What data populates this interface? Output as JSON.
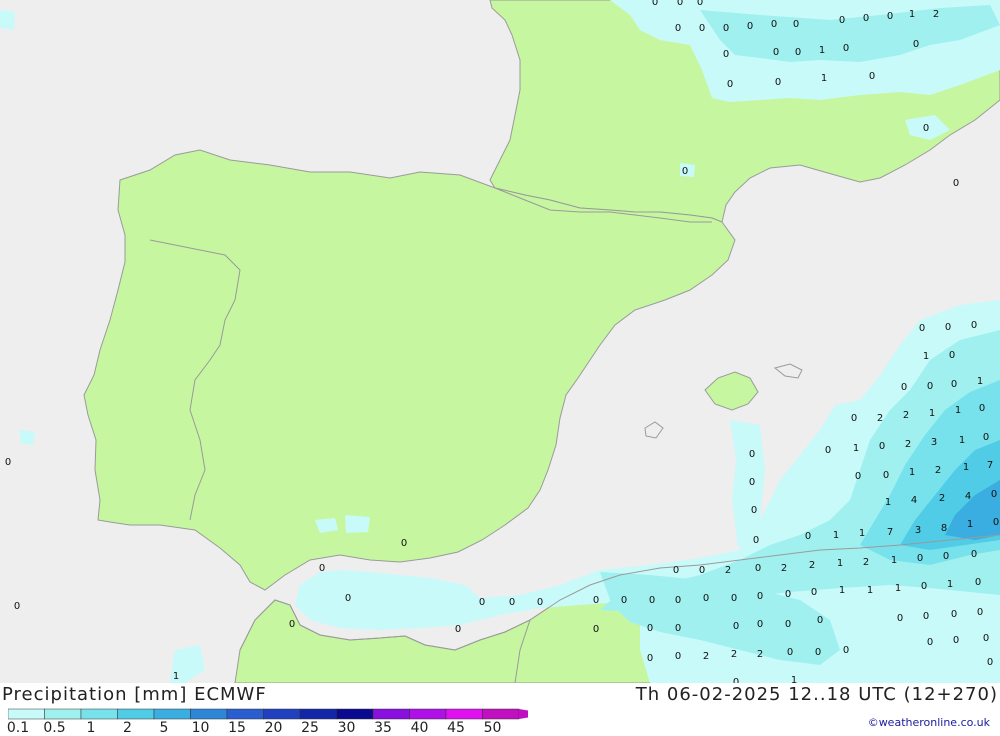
{
  "header": {
    "title": "Precipitation [mm] ECMWF",
    "datetime": "Th 06-02-2025 12..18 UTC (12+270)",
    "credit": "©weatheronline.co.uk"
  },
  "colors": {
    "land": "#c6f7a0",
    "sea": "#eeeeee",
    "border": "#9a9a9a",
    "precip_levels": [
      "#c8fafa",
      "#a0f0f0",
      "#78e2ec",
      "#50cce6",
      "#3aaee0",
      "#2e86d8",
      "#2a5ed0",
      "#2040c0",
      "#1426a8",
      "#0a0a90",
      "#8a10e0",
      "#b010e8",
      "#e010f0",
      "#c010c0"
    ]
  },
  "legend": {
    "labels": [
      "0.1",
      "0.5",
      "1",
      "2",
      "5",
      "10",
      "15",
      "20",
      "25",
      "30",
      "35",
      "40",
      "45",
      "50"
    ]
  },
  "map_values": [
    {
      "t": "0"
    },
    {
      "t": "0"
    },
    {
      "t": "0"
    },
    {
      "t": "1"
    },
    {
      "t": "2"
    },
    {
      "t": "0"
    },
    {
      "t": "0"
    },
    {
      "t": "0"
    },
    {
      "t": "0"
    },
    {
      "t": "0"
    },
    {
      "t": "0"
    },
    {
      "t": "0"
    },
    {
      "t": "0"
    },
    {
      "t": "0"
    },
    {
      "t": "0"
    },
    {
      "t": "0"
    },
    {
      "t": "0"
    },
    {
      "t": "1"
    },
    {
      "t": "0"
    },
    {
      "t": "0"
    },
    {
      "t": "0"
    },
    {
      "t": "1"
    },
    {
      "t": "0"
    },
    {
      "t": "0"
    },
    {
      "t": "0"
    },
    {
      "t": "0"
    },
    {
      "t": "0"
    },
    {
      "t": "0"
    },
    {
      "t": "0"
    },
    {
      "t": "0"
    },
    {
      "t": "0"
    },
    {
      "t": "0"
    },
    {
      "t": "1"
    },
    {
      "t": "0"
    },
    {
      "t": "0"
    },
    {
      "t": "0"
    },
    {
      "t": "1"
    },
    {
      "t": "0"
    },
    {
      "t": "0"
    },
    {
      "t": "2"
    },
    {
      "t": "2"
    },
    {
      "t": "1"
    },
    {
      "t": "1"
    },
    {
      "t": "0"
    },
    {
      "t": "0"
    },
    {
      "t": "1"
    },
    {
      "t": "0"
    },
    {
      "t": "2"
    },
    {
      "t": "3"
    },
    {
      "t": "1"
    },
    {
      "t": "0"
    },
    {
      "t": "0"
    },
    {
      "t": "0"
    },
    {
      "t": "1"
    },
    {
      "t": "2"
    },
    {
      "t": "1"
    },
    {
      "t": "7"
    },
    {
      "t": "0"
    },
    {
      "t": "0"
    },
    {
      "t": "1"
    },
    {
      "t": "4"
    },
    {
      "t": "2"
    },
    {
      "t": "4"
    },
    {
      "t": "0"
    },
    {
      "t": "0"
    },
    {
      "t": "0"
    },
    {
      "t": "1"
    },
    {
      "t": "1"
    },
    {
      "t": "7"
    },
    {
      "t": "3"
    },
    {
      "t": "8"
    },
    {
      "t": "1"
    },
    {
      "t": "0"
    },
    {
      "t": "0"
    },
    {
      "t": "0"
    },
    {
      "t": "0"
    },
    {
      "t": "0"
    },
    {
      "t": "0"
    },
    {
      "t": "2"
    },
    {
      "t": "0"
    },
    {
      "t": "2"
    },
    {
      "t": "2"
    },
    {
      "t": "1"
    },
    {
      "t": "2"
    },
    {
      "t": "1"
    },
    {
      "t": "0"
    },
    {
      "t": "0"
    },
    {
      "t": "0"
    },
    {
      "t": "0"
    },
    {
      "t": "0"
    },
    {
      "t": "0"
    },
    {
      "t": "0"
    },
    {
      "t": "0"
    },
    {
      "t": "0"
    },
    {
      "t": "0"
    },
    {
      "t": "0"
    },
    {
      "t": "0"
    },
    {
      "t": "0"
    },
    {
      "t": "0"
    },
    {
      "t": "0"
    },
    {
      "t": "1"
    },
    {
      "t": "1"
    },
    {
      "t": "1"
    },
    {
      "t": "0"
    },
    {
      "t": "1"
    },
    {
      "t": "0"
    },
    {
      "t": "0"
    },
    {
      "t": "0"
    },
    {
      "t": "0"
    },
    {
      "t": "0"
    },
    {
      "t": "0"
    },
    {
      "t": "0"
    },
    {
      "t": "0"
    },
    {
      "t": "0"
    },
    {
      "t": "0"
    },
    {
      "t": "0"
    },
    {
      "t": "0"
    },
    {
      "t": "0"
    },
    {
      "t": "0"
    },
    {
      "t": "0"
    },
    {
      "t": "0"
    },
    {
      "t": "0"
    },
    {
      "t": "2"
    },
    {
      "t": "2"
    },
    {
      "t": "2"
    },
    {
      "t": "0"
    },
    {
      "t": "0"
    },
    {
      "t": "0"
    },
    {
      "t": "0"
    },
    {
      "t": "0"
    },
    {
      "t": "0"
    },
    {
      "t": "1"
    },
    {
      "t": "1"
    },
    {
      "t": "0"
    },
    {
      "t": "0"
    },
    {
      "t": "0"
    },
    {
      "t": "0"
    },
    {
      "t": "0"
    },
    {
      "t": "0"
    },
    {
      "t": "0"
    },
    {
      "t": "0"
    },
    {
      "t": "0"
    },
    {
      "t": "0"
    },
    {
      "t": "0"
    },
    {
      "t": "0"
    },
    {
      "t": "0"
    },
    {
      "t": "0"
    },
    {
      "t": "0"
    },
    {
      "t": "0"
    }
  ]
}
